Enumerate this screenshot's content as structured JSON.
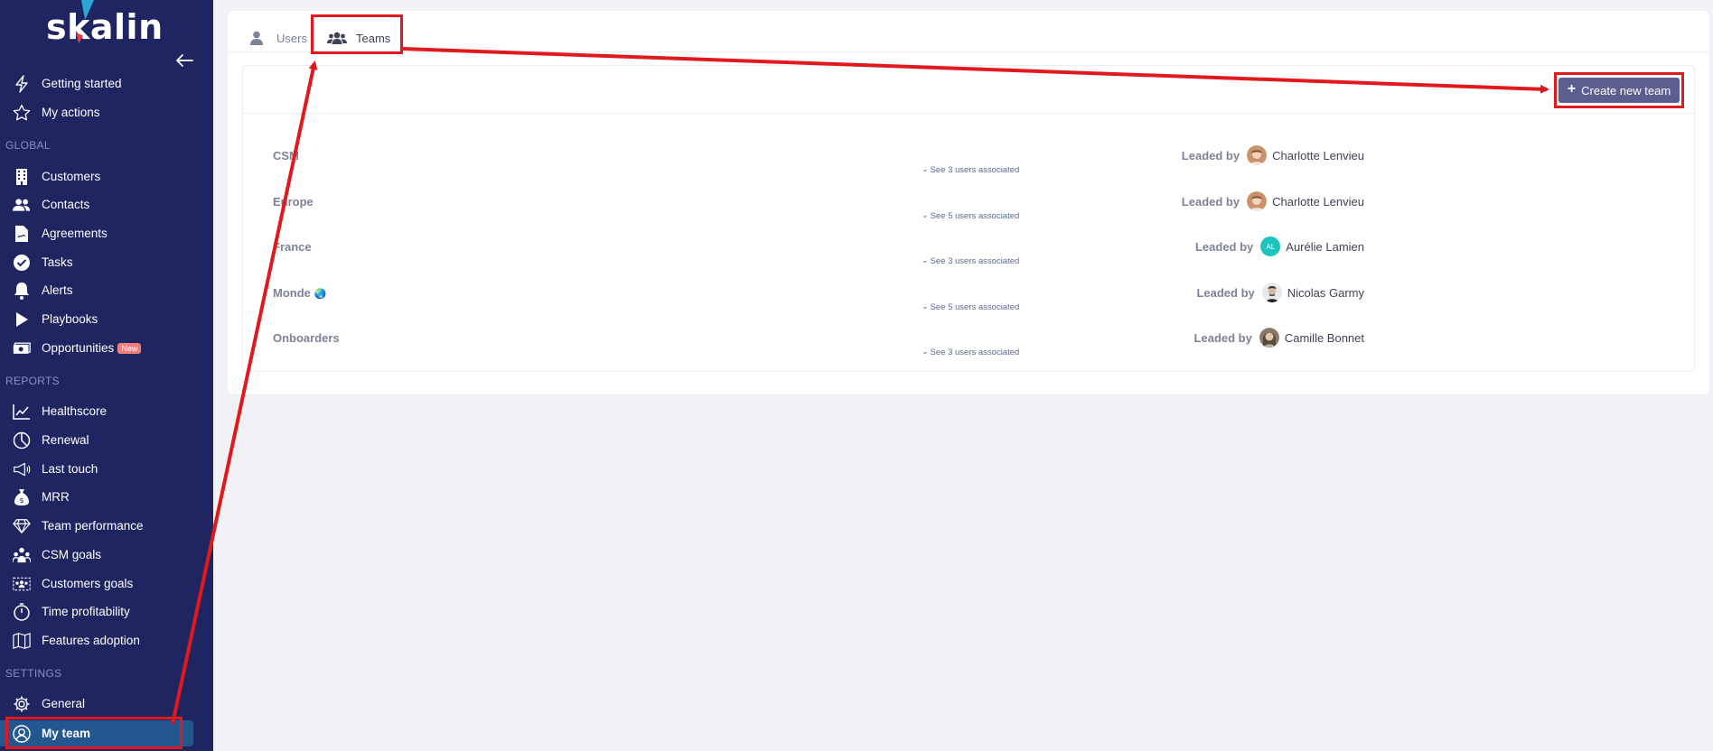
{
  "brand": {
    "name": "skalin"
  },
  "sidebar": {
    "top_items": [
      {
        "label": "Getting started",
        "icon": "lightning-icon"
      },
      {
        "label": "My actions",
        "icon": "star-icon"
      }
    ],
    "sections": {
      "global": "GLOBAL",
      "reports": "REPORTS",
      "settings": "SETTINGS"
    },
    "global_items": [
      {
        "label": "Customers",
        "icon": "building-icon"
      },
      {
        "label": "Contacts",
        "icon": "users-icon"
      },
      {
        "label": "Agreements",
        "icon": "document-icon"
      },
      {
        "label": "Tasks",
        "icon": "check-circle-icon"
      },
      {
        "label": "Alerts",
        "icon": "bell-icon"
      },
      {
        "label": "Playbooks",
        "icon": "play-icon"
      },
      {
        "label": "Opportunities",
        "icon": "money-icon",
        "badge": "New"
      }
    ],
    "report_items": [
      {
        "label": "Healthscore",
        "icon": "line-chart-icon"
      },
      {
        "label": "Renewal",
        "icon": "pie-chart-icon"
      },
      {
        "label": "Last touch",
        "icon": "megaphone-icon"
      },
      {
        "label": "MRR",
        "icon": "money-bag-icon"
      },
      {
        "label": "Team performance",
        "icon": "diamond-icon"
      },
      {
        "label": "CSM goals",
        "icon": "team-goals-icon"
      },
      {
        "label": "Customers goals",
        "icon": "customers-goals-icon"
      },
      {
        "label": "Time profitability",
        "icon": "stopwatch-icon"
      },
      {
        "label": "Features adoption",
        "icon": "map-icon"
      }
    ],
    "settings_items": [
      {
        "label": "General",
        "icon": "gear-icon"
      },
      {
        "label": "My team",
        "icon": "user-circle-icon",
        "active": true
      }
    ]
  },
  "tabs": [
    {
      "label": "Users",
      "icon": "user-icon"
    },
    {
      "label": "Teams",
      "icon": "group-icon",
      "active": true
    }
  ],
  "toolbar": {
    "create_label": "Create new team"
  },
  "teams": [
    {
      "name": "CSM",
      "users_link": "See 3 users associated",
      "leaded_by": "Leaded by",
      "leader": "Charlotte Lenvieu",
      "avatar": "photo",
      "avatar_color": "#c8926b"
    },
    {
      "name": "Europe",
      "users_link": "See 5 users associated",
      "leaded_by": "Leaded by",
      "leader": "Charlotte Lenvieu",
      "avatar": "photo",
      "avatar_color": "#c8926b"
    },
    {
      "name": "France",
      "users_link": "See 3 users associated",
      "leaded_by": "Leaded by",
      "leader": "Aurélie Lamien",
      "avatar": "initials",
      "avatar_initials": "AL",
      "avatar_color": "#1bc5bd"
    },
    {
      "name": "Monde",
      "emoji": "🌏",
      "users_link": "See 5 users associated",
      "leaded_by": "Leaded by",
      "leader": "Nicolas Garmy",
      "avatar": "photo",
      "avatar_color": "#d9d9d9"
    },
    {
      "name": "Onboarders",
      "users_link": "See 3 users associated",
      "leaded_by": "Leaded by",
      "leader": "Camille Bonnet",
      "avatar": "photo",
      "avatar_color": "#8a7a6a"
    }
  ],
  "colors": {
    "sidebar_bg": "#1f2560",
    "active_bg": "#24578f",
    "button_bg": "#5c5e8f",
    "annotation_red": "#e0191e"
  }
}
